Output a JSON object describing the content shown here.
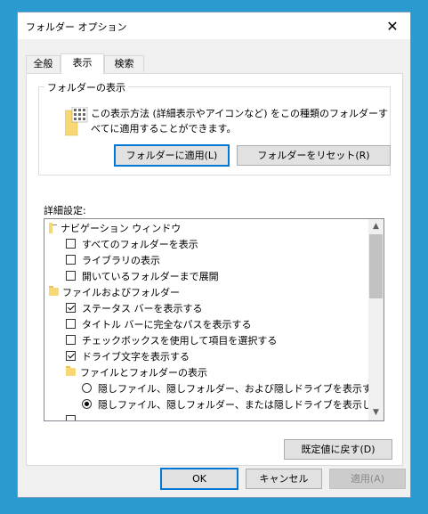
{
  "window": {
    "title": "フォルダー オプション",
    "close_glyph": "✕"
  },
  "tabs": [
    {
      "label": "全般"
    },
    {
      "label": "表示"
    },
    {
      "label": "検索"
    }
  ],
  "folder_view": {
    "group_title": "フォルダーの表示",
    "description": "この表示方法 (詳細表示やアイコンなど) をこの種類のフォルダーすべてに適用することができます。",
    "apply_button": "フォルダーに適用(L)",
    "reset_button": "フォルダーをリセット(R)"
  },
  "advanced": {
    "label": "詳細設定:",
    "items": [
      {
        "type": "nav",
        "label": "ナビゲーション ウィンドウ"
      },
      {
        "type": "checkbox",
        "checked": false,
        "label": "すべてのフォルダーを表示"
      },
      {
        "type": "checkbox",
        "checked": false,
        "label": "ライブラリの表示"
      },
      {
        "type": "checkbox",
        "checked": false,
        "label": "開いているフォルダーまで展開"
      },
      {
        "type": "folder",
        "label": "ファイルおよびフォルダー"
      },
      {
        "type": "checkbox",
        "checked": true,
        "label": "ステータス バーを表示する"
      },
      {
        "type": "checkbox",
        "checked": false,
        "label": "タイトル バーに完全なパスを表示する"
      },
      {
        "type": "checkbox",
        "checked": false,
        "label": "チェックボックスを使用して項目を選択する"
      },
      {
        "type": "checkbox",
        "checked": true,
        "label": "ドライブ文字を表示する"
      },
      {
        "type": "folder2",
        "label": "ファイルとフォルダーの表示"
      },
      {
        "type": "radio",
        "checked": false,
        "label": "隠しファイル、隠しフォルダー、および隠しドライブを表示する"
      },
      {
        "type": "radio",
        "checked": true,
        "label": "隠しファイル、隠しフォルダー、または隠しドライブを表示しない"
      }
    ],
    "restore_button": "既定値に戻す(D)"
  },
  "footer": {
    "ok": "OK",
    "cancel": "キャンセル",
    "apply": "適用(A)"
  },
  "colors": {
    "accent": "#0078d7",
    "desktop": "#2a9bd0"
  }
}
